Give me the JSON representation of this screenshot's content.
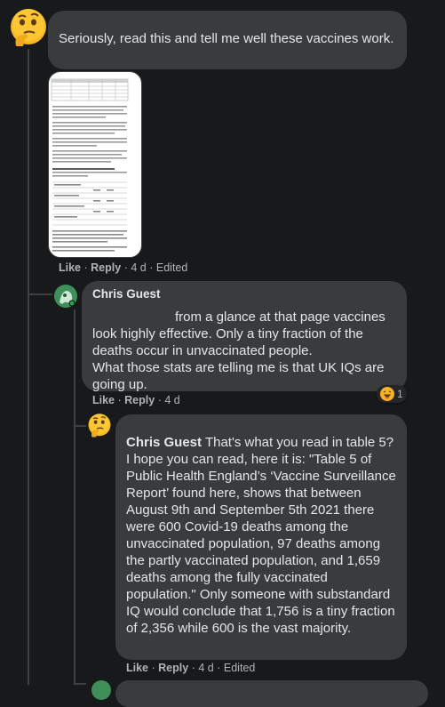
{
  "comments": [
    {
      "text": "Seriously, read this and tell me well these vaccines work.",
      "actions": {
        "like": "Like",
        "reply": "Reply",
        "time": "4 d",
        "edited": "Edited"
      }
    },
    {
      "author": "Chris Guest",
      "text": "from a glance at that page vaccines look highly effective. Only a tiny fraction of the deaths occur in unvaccinated people.\nWhat those stats are telling me is that UK IQs are going up.",
      "reaction_count": "1",
      "actions": {
        "like": "Like",
        "reply": "Reply",
        "time": "4 d"
      }
    },
    {
      "author": "Chris Guest",
      "text": "That's what you read in table 5? I hope you can read, here it is: \"Table 5 of Public Health England’s ‘Vaccine Surveillance Report’ found here, shows that between August 9th and September 5th 2021 there were 600 Covid-19 deaths among the unvaccinated population, 97 deaths among the partly vaccinated population, and 1,659 deaths among the fully vaccinated population.\" Only someone with substandard IQ would conclude that 1,756 is a tiny fraction of 2,356 while 600 is the vast majority.",
      "actions": {
        "like": "Like",
        "reply": "Reply",
        "time": "4 d",
        "edited": "Edited"
      }
    }
  ],
  "separator": "·",
  "icons": {
    "thinking": "thinking-face-icon",
    "haha": "haha-reaction-icon"
  }
}
